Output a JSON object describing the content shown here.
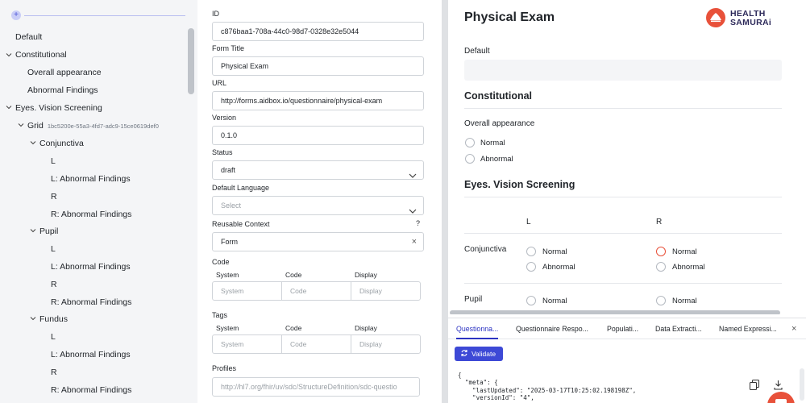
{
  "tree": {
    "items": [
      {
        "label": "Default",
        "expanded": null
      },
      {
        "label": "Constitutional",
        "expanded": true
      },
      {
        "label": "Overall appearance",
        "expanded": null
      },
      {
        "label": "Abnormal Findings",
        "expanded": null
      },
      {
        "label": "Eyes. Vision Screening",
        "expanded": true
      },
      {
        "label": "Grid",
        "id": "1bc5200e-55a3-4fd7-adc9-15ce0619def0",
        "expanded": true
      },
      {
        "label": "Conjunctiva",
        "expanded": true
      },
      {
        "label": "L",
        "expanded": null
      },
      {
        "label": "L: Abnormal Findings",
        "expanded": null
      },
      {
        "label": "R",
        "expanded": null
      },
      {
        "label": "R: Abnormal Findings",
        "expanded": null
      },
      {
        "label": "Pupil",
        "expanded": true
      },
      {
        "label": "L",
        "expanded": null
      },
      {
        "label": "L: Abnormal Findings",
        "expanded": null
      },
      {
        "label": "R",
        "expanded": null
      },
      {
        "label": "R: Abnormal Findings",
        "expanded": null
      },
      {
        "label": "Fundus",
        "expanded": true
      },
      {
        "label": "L",
        "expanded": null
      },
      {
        "label": "L: Abnormal Findings",
        "expanded": null
      },
      {
        "label": "R",
        "expanded": null
      },
      {
        "label": "R: Abnormal Findings",
        "expanded": null
      }
    ]
  },
  "form": {
    "id_label": "ID",
    "id_value": "c876baa1-708a-44c0-98d7-0328e32e5044",
    "title_label": "Form Title",
    "title_value": "Physical Exam",
    "url_label": "URL",
    "url_value": "http://forms.aidbox.io/questionnaire/physical-exam",
    "version_label": "Version",
    "version_value": "0.1.0",
    "status_label": "Status",
    "status_value": "draft",
    "language_label": "Default Language",
    "language_placeholder": "Select",
    "context_label": "Reusable Context",
    "context_help": "?",
    "context_value": "Form",
    "code_label": "Code",
    "code_columns": [
      "System",
      "Code",
      "Display"
    ],
    "code_placeholders": [
      "System",
      "Code",
      "Display"
    ],
    "tags_label": "Tags",
    "tags_columns": [
      "System",
      "Code",
      "Display"
    ],
    "tags_placeholders": [
      "System",
      "Code",
      "Display"
    ],
    "profiles_label": "Profiles",
    "profiles_value": "http://hl7.org/fhir/uv/sdc/StructureDefinition/sdc-questio"
  },
  "preview": {
    "title": "Physical Exam",
    "logo_line1": "HEALTH",
    "logo_line2": "SAMURAi",
    "default_label": "Default",
    "constitutional_heading": "Constitutional",
    "overall_label": "Overall appearance",
    "overall_options": [
      "Normal",
      "Abnormal"
    ],
    "eyes_heading": "Eyes. Vision Screening",
    "col_l": "L",
    "col_r": "R",
    "conjunctiva_label": "Conjunctiva",
    "conjunctiva_l": [
      "Normal",
      "Abnormal"
    ],
    "conjunctiva_r": [
      "Normal",
      "Abnormal"
    ],
    "pupil_label": "Pupil",
    "pupil_l": [
      "Normal"
    ],
    "pupil_r": [
      "Normal"
    ]
  },
  "bottom": {
    "tabs": [
      "Questionna...",
      "Questionnaire Respo...",
      "Populati...",
      "Data Extracti...",
      "Named Expressi..."
    ],
    "active_tab": 0,
    "close": "×",
    "validate_label": "Validate",
    "code_lines": [
      "{",
      "  \"meta\": {",
      "    \"lastUpdated\": \"2025-03-17T10:25:02.198198Z\",",
      "    \"versionId\": \"4\","
    ]
  },
  "colors": {
    "accent": "#3d49d6",
    "brand": "#e8513a",
    "panel_bg": "#f4f5f7"
  }
}
